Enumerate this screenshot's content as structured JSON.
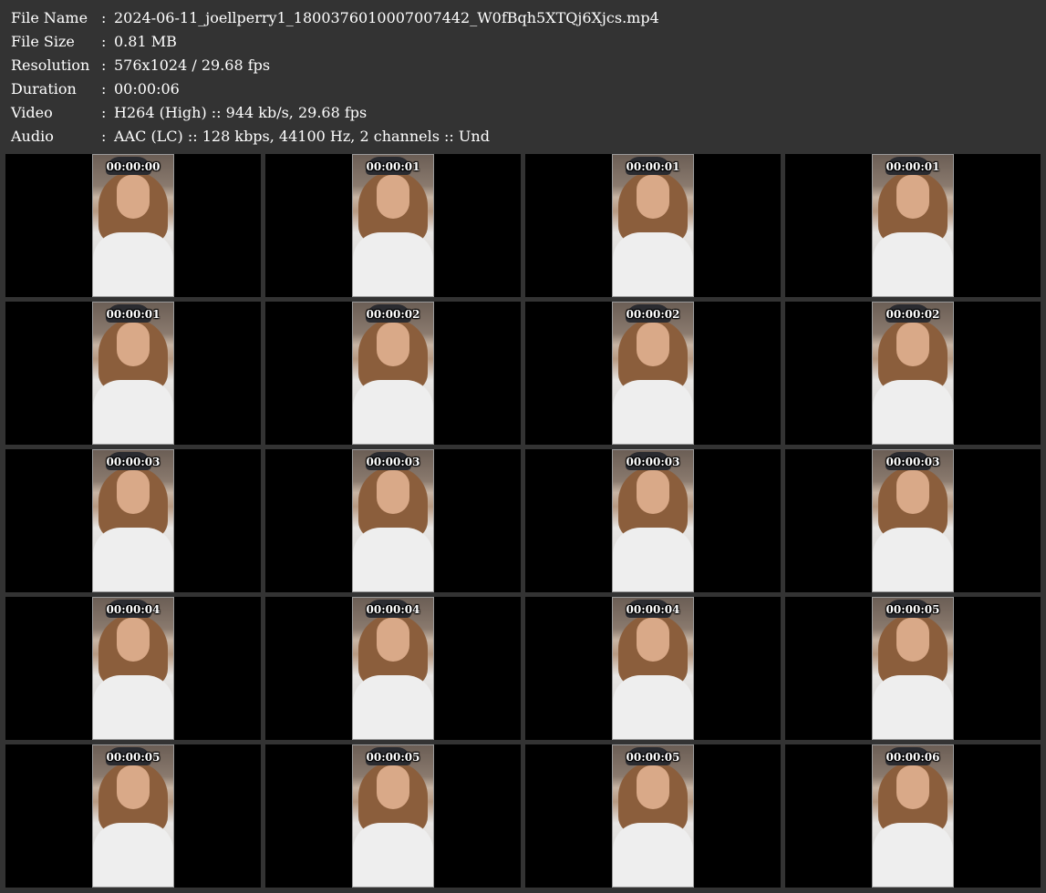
{
  "info": [
    {
      "label": "File Name",
      "value": "2024-06-11_joellperry1_1800376010007007442_W0fBqh5XTQj6Xjcs.mp4"
    },
    {
      "label": "File Size",
      "value": "0.81 MB"
    },
    {
      "label": "Resolution",
      "value": "576x1024 / 29.68 fps"
    },
    {
      "label": "Duration",
      "value": "00:00:06"
    },
    {
      "label": "Video",
      "value": "H264 (High) :: 944 kb/s, 29.68 fps"
    },
    {
      "label": "Audio",
      "value": "AAC (LC) :: 128 kbps, 44100 Hz, 2 channels :: Und"
    }
  ],
  "separator": ":",
  "thumbnails": [
    "00:00:00",
    "00:00:01",
    "00:00:01",
    "00:00:01",
    "00:00:01",
    "00:00:02",
    "00:00:02",
    "00:00:02",
    "00:00:03",
    "00:00:03",
    "00:00:03",
    "00:00:03",
    "00:00:04",
    "00:00:04",
    "00:00:04",
    "00:00:05",
    "00:00:05",
    "00:00:05",
    "00:00:05",
    "00:00:06"
  ]
}
